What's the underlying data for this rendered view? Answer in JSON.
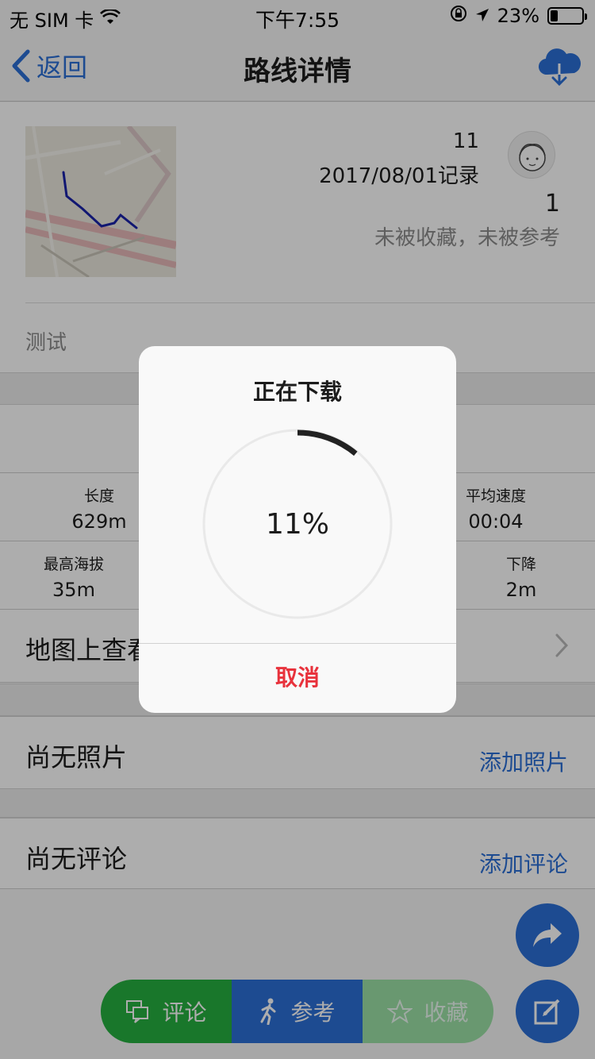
{
  "status_bar": {
    "carrier": "无 SIM 卡",
    "time": "下午7:55",
    "battery": "23%",
    "battery_level": 0.23
  },
  "nav": {
    "back_label": "返回",
    "title": "路线详情",
    "download_icon": "cloud-download-icon"
  },
  "route": {
    "count": "11",
    "date": "2017/08/01记录",
    "likes": "1",
    "fav_status": "未被收藏，未被参考",
    "description": "测试"
  },
  "stats": [
    {
      "label": "长度",
      "value": "629m"
    },
    {
      "label": "平均速度",
      "value": "00:04"
    },
    {
      "label": "最高海拔",
      "value": "35m"
    },
    {
      "label": "下降",
      "value": "2m"
    }
  ],
  "map_row": {
    "label": "地图上查看"
  },
  "photos": {
    "label": "尚无照片",
    "action": "添加照片"
  },
  "comments": {
    "label": "尚无评论",
    "action": "添加评论"
  },
  "bottom_bar": {
    "comment": "评论",
    "reference": "参考",
    "favorite": "收藏"
  },
  "dialog": {
    "title": "正在下载",
    "percent": "11%",
    "progress": 0.11,
    "cancel": "取消"
  },
  "colors": {
    "accent": "#2b6fd6",
    "green": "#25b040",
    "danger": "#e8323c"
  }
}
